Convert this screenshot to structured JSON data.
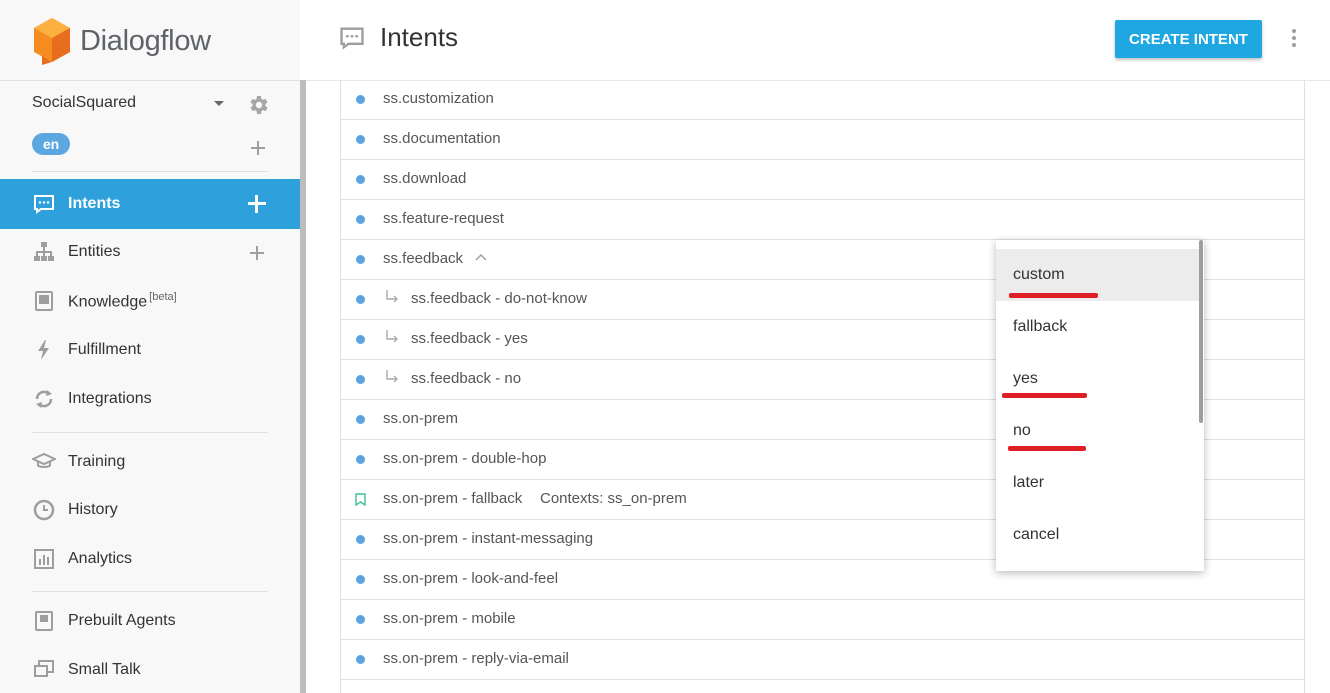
{
  "app": {
    "name": "Dialogflow"
  },
  "agent": {
    "name": "SocialSquared",
    "language": "en"
  },
  "sidebar": {
    "items": [
      {
        "label": "Intents"
      },
      {
        "label": "Entities"
      },
      {
        "label": "Knowledge",
        "badge": "[beta]"
      },
      {
        "label": "Fulfillment"
      },
      {
        "label": "Integrations"
      },
      {
        "label": "Training"
      },
      {
        "label": "History"
      },
      {
        "label": "Analytics"
      },
      {
        "label": "Prebuilt Agents"
      },
      {
        "label": "Small Talk"
      }
    ]
  },
  "header": {
    "title": "Intents",
    "create_label": "CREATE INTENT"
  },
  "intents": [
    {
      "name": "ss.customization"
    },
    {
      "name": "ss.documentation"
    },
    {
      "name": "ss.download"
    },
    {
      "name": "ss.feature-request"
    },
    {
      "name": "ss.feedback"
    },
    {
      "name": "ss.feedback - do-not-know"
    },
    {
      "name": "ss.feedback - yes"
    },
    {
      "name": "ss.feedback - no"
    },
    {
      "name": "ss.on-prem"
    },
    {
      "name": "ss.on-prem - double-hop"
    },
    {
      "name": "ss.on-prem - fallback",
      "contexts": "Contexts: ss_on-prem"
    },
    {
      "name": "ss.on-prem - instant-messaging"
    },
    {
      "name": "ss.on-prem - look-and-feel"
    },
    {
      "name": "ss.on-prem - mobile"
    },
    {
      "name": "ss.on-prem - reply-via-email"
    }
  ],
  "dropdown": {
    "options": [
      "custom",
      "fallback",
      "yes",
      "no",
      "later",
      "cancel"
    ],
    "highlighted": "custom"
  },
  "colors": {
    "accent": "#2ea1dd",
    "button": "#1fa7e1",
    "dot": "#5aa3e0",
    "underline": "#e01e25"
  }
}
